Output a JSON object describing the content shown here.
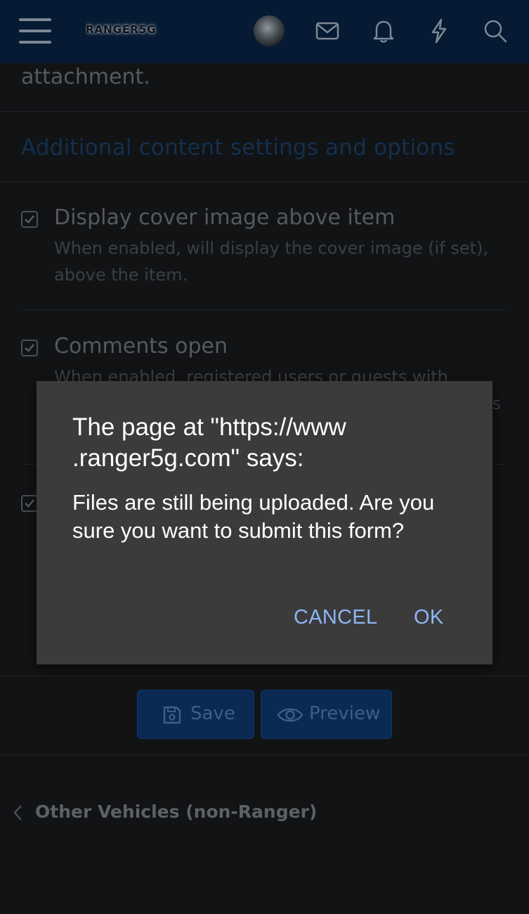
{
  "header": {
    "logo_text": "RANGER5G",
    "icons": [
      "menu-icon",
      "avatar",
      "mail-icon",
      "bell-icon",
      "lightning-icon",
      "search-icon"
    ]
  },
  "form": {
    "attachment_tail": "attachment.",
    "section_title": "Additional content settings and options",
    "options": [
      {
        "title": "Display cover image above item",
        "description": "When enabled, will display the cover image (if set), above the item.",
        "checked": true
      },
      {
        "title": "Comments open",
        "description": "When enabled, registered users or guests with",
        "description_fragment": "is",
        "checked": true
      },
      {
        "title": "",
        "checked": true
      }
    ],
    "save_label": "Save",
    "preview_label": "Preview"
  },
  "breadcrumb": {
    "label": "Other Vehicles (non-Ranger)"
  },
  "dialog": {
    "title": "The page at \"https://www .ranger5g.com\" says:",
    "message": "Files are still being uploaded. Are you sure you want to submit this form?",
    "cancel_label": "CANCEL",
    "ok_label": "OK"
  },
  "colors": {
    "header_bg": "#061a33",
    "page_bg": "#121314",
    "dialog_bg": "#3b3b3b",
    "dialog_button": "#8fb4f6",
    "section_title": "#12304f"
  }
}
